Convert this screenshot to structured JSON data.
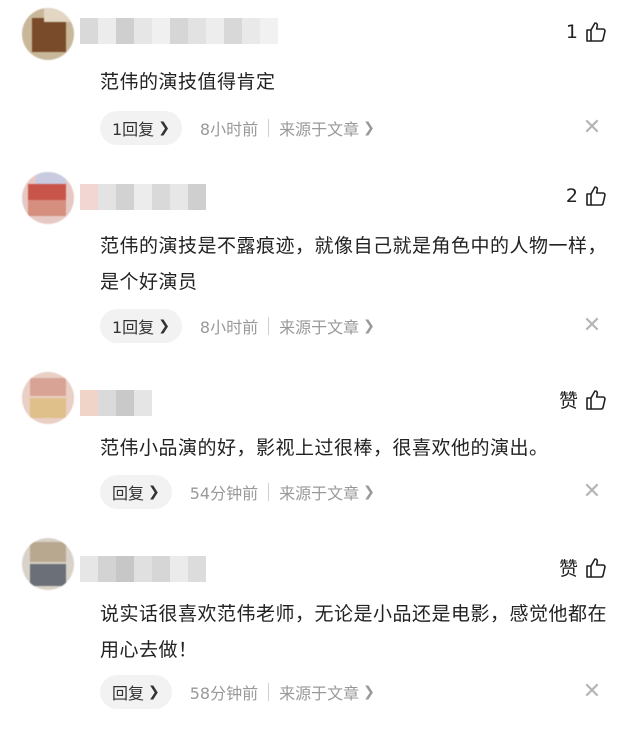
{
  "comments": [
    {
      "text": "范伟的演技值得肯定",
      "like_label": "1",
      "reply_label": "1回复",
      "time": "8小时前",
      "source": "来源于文章"
    },
    {
      "text": "范伟的演技是不露痕迹，就像自己就是角色中的人物一样，是个好演员",
      "like_label": "2",
      "reply_label": "1回复",
      "time": "8小时前",
      "source": "来源于文章"
    },
    {
      "text": "范伟小品演的好，影视上过很棒，很喜欢他的演出。",
      "like_label": "赞",
      "reply_label": "回复",
      "time": "54分钟前",
      "source": "来源于文章"
    },
    {
      "text": "说实话很喜欢范伟老师，无论是小品还是电影，感觉他都在用心去做！",
      "like_label": "赞",
      "reply_label": "回复",
      "time": "58分钟前",
      "source": "来源于文章"
    }
  ],
  "icons": {
    "like": "thumbs-up-icon",
    "close": "close-icon",
    "chevron": "chevron-right-icon"
  },
  "colors": {
    "text": "#222222",
    "meta": "#999999",
    "pill_bg": "#f2f2f2"
  }
}
